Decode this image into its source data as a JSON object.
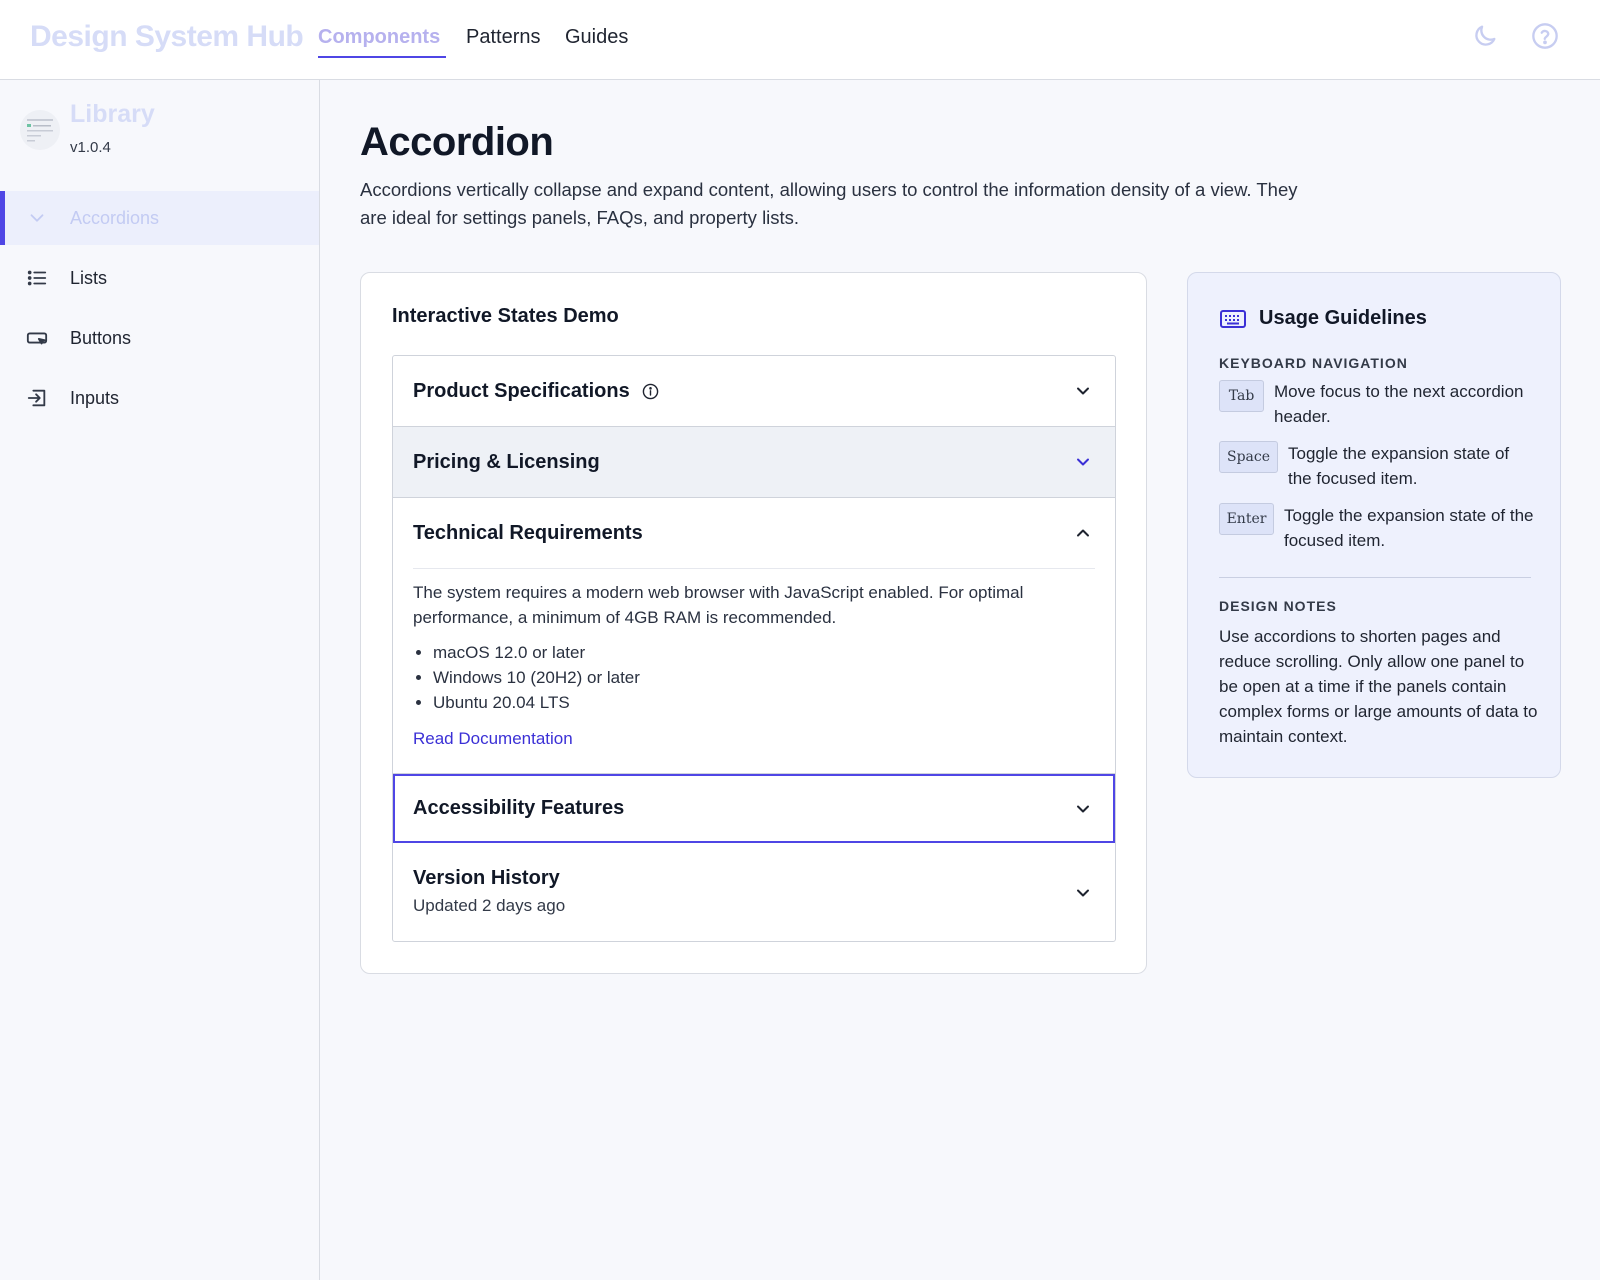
{
  "header": {
    "brand": "Design System Hub",
    "tabs": [
      {
        "label": "Components",
        "active": true
      },
      {
        "label": "Patterns",
        "active": false
      },
      {
        "label": "Guides",
        "active": false
      }
    ],
    "icons": [
      "moon-icon",
      "help-icon"
    ]
  },
  "sidebar": {
    "title": "Library",
    "version": "v1.0.4",
    "items": [
      {
        "label": "Accordions",
        "icon": "chevron-down-icon",
        "active": true
      },
      {
        "label": "Lists",
        "icon": "list-icon",
        "active": false
      },
      {
        "label": "Buttons",
        "icon": "button-icon",
        "active": false
      },
      {
        "label": "Inputs",
        "icon": "input-icon",
        "active": false
      }
    ]
  },
  "main": {
    "title": "Accordion",
    "description": "Accordions vertically collapse and expand content, allowing users to control the information density of a view. They are ideal for settings panels, FAQs, and property lists."
  },
  "demo": {
    "title": "Interactive States Demo",
    "items": [
      {
        "title": "Product Specifications",
        "state": "collapsed",
        "has_info": true
      },
      {
        "title": "Pricing & Licensing",
        "state": "hover"
      },
      {
        "title": "Technical Requirements",
        "state": "expanded",
        "body": "The system requires a modern web browser with JavaScript enabled. For optimal performance, a minimum of 4GB RAM is recommended.",
        "bullets": [
          "macOS 12.0 or later",
          "Windows 10 (20H2) or later",
          "Ubuntu 20.04 LTS"
        ],
        "link": "Read Documentation"
      },
      {
        "title": "Accessibility Features",
        "state": "focused"
      },
      {
        "title": "Version History",
        "state": "collapsed",
        "subtitle": "Updated 2 days ago"
      }
    ]
  },
  "usage": {
    "title": "Usage Guidelines",
    "keyboard_label": "KEYBOARD NAVIGATION",
    "keys": [
      {
        "key": "Tab",
        "desc": "Move focus to the next accordion header."
      },
      {
        "key": "Space",
        "desc": "Toggle the expansion state of the focused item."
      },
      {
        "key": "Enter",
        "desc": "Toggle the expansion state of the focused item."
      }
    ],
    "notes_label": "DESIGN NOTES",
    "notes": "Use accordions to shorten pages and reduce scrolling. Only allow one panel to be open at a time if the panels contain complex forms or large amounts of data to maintain context."
  },
  "colors": {
    "accent": "#4f46e5",
    "link": "#3b30d6",
    "hover_row": "#eef1f6",
    "usage_bg": "#eef1fd"
  }
}
